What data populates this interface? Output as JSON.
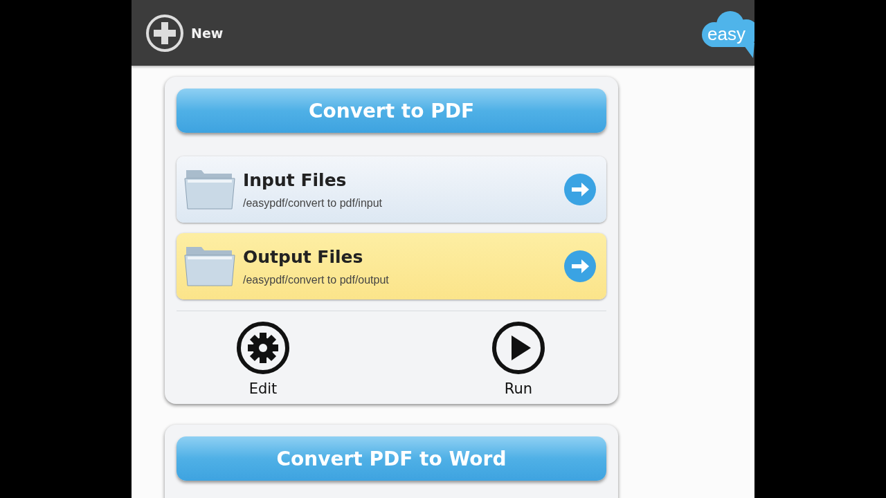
{
  "header": {
    "new_label": "New",
    "logo_text": "easy"
  },
  "cards": [
    {
      "title": "Convert to PDF",
      "folders": [
        {
          "label": "Input Files",
          "path": "/easypdf/convert to pdf/input",
          "selected": false
        },
        {
          "label": "Output Files",
          "path": "/easypdf/convert to pdf/output",
          "selected": true
        }
      ],
      "actions": [
        {
          "kind": "edit",
          "label": "Edit"
        },
        {
          "kind": "run",
          "label": "Run"
        }
      ]
    },
    {
      "title": "Convert PDF to Word"
    }
  ]
}
